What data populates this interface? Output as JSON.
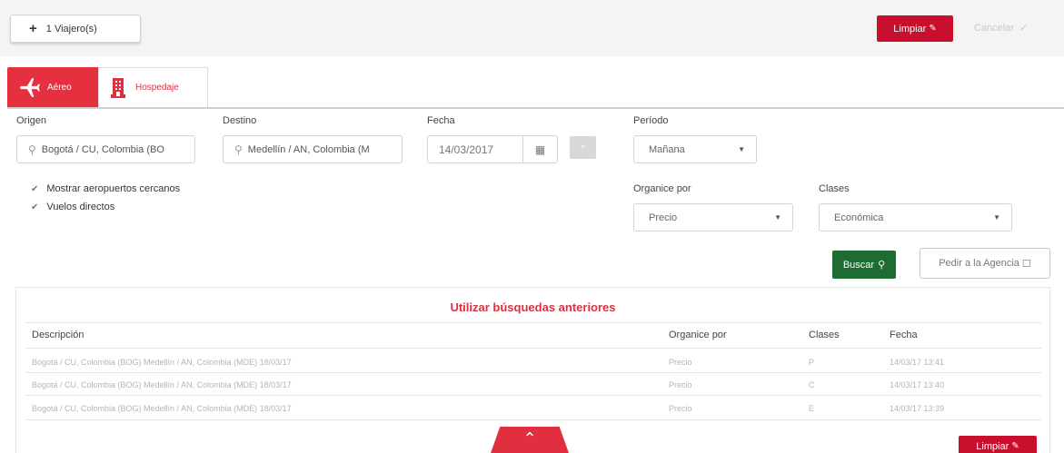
{
  "topbar": {
    "travelers_label": "1 Viajero(s)",
    "clear_label": "Limpiar",
    "cancel_label": "Cancelar"
  },
  "tabs": [
    {
      "label": "Aéreo",
      "icon": "airplane-icon"
    },
    {
      "label": "Hospedaje",
      "icon": "hotel-icon"
    }
  ],
  "form": {
    "origin_label": "Origen",
    "origin_value": "Bogotá / CU, Colombia (BO",
    "destination_label": "Destino",
    "destination_value": "Medellín / AN, Colombia (M",
    "date_label": "Fecha",
    "date_value": "14/03/2017",
    "period_label": "Período",
    "period_value": "Mañana",
    "nearby_airports_label": "Mostrar aeropuertos cercanos",
    "direct_flights_label": "Vuelos directos",
    "sort_label": "Organice por",
    "sort_value": "Precio",
    "class_label": "Clases",
    "class_value": "Económica",
    "search_label": "Buscar",
    "agency_label": "Pedir a la Agencia"
  },
  "history": {
    "title": "Utilizar búsquedas anteriores",
    "headers": [
      "Descripción",
      "Organice por",
      "Clases",
      "Fecha"
    ],
    "rows": [
      [
        "Bogotá / CU, Colombia (BOG) Medellín / AN, Colombia (MDE) 18/03/17",
        "Precio",
        "P",
        "14/03/17 13:41"
      ],
      [
        "Bogotá / CU, Colombia (BOG) Medellín / AN, Colombia (MDE) 18/03/17",
        "Precio",
        "C",
        "14/03/17 13:40"
      ],
      [
        "Bogotá / CU, Colombia (BOG) Medellín / AN, Colombia (MDE) 18/03/17",
        "Precio",
        "E",
        "14/03/17 13:39"
      ]
    ]
  },
  "bottom": {
    "clear_label": "Limpiar"
  },
  "colors": {
    "brand_red": "#c8102e",
    "tab_red": "#e63040",
    "search_green": "#1e6b34"
  }
}
